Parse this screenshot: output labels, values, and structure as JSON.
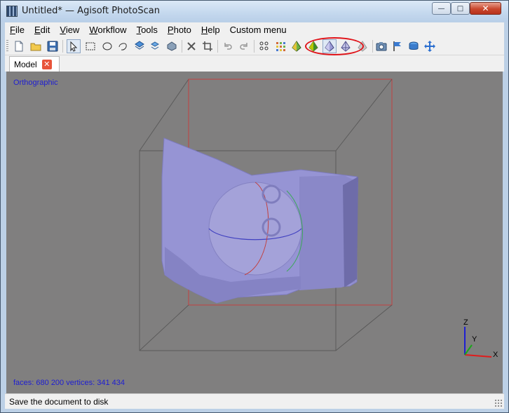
{
  "window": {
    "title": "Untitled* — Agisoft PhotoScan"
  },
  "controls": {
    "minimize": "—",
    "maximize": "□",
    "close": "✕"
  },
  "menu": {
    "items": [
      {
        "label": "File",
        "mnemonic": "F"
      },
      {
        "label": "Edit",
        "mnemonic": "E"
      },
      {
        "label": "View",
        "mnemonic": "V"
      },
      {
        "label": "Workflow",
        "mnemonic": "W"
      },
      {
        "label": "Tools",
        "mnemonic": "T"
      },
      {
        "label": "Photo",
        "mnemonic": "P"
      },
      {
        "label": "Help",
        "mnemonic": "H"
      },
      {
        "label": "Custom menu",
        "mnemonic": ""
      }
    ]
  },
  "toolbar": {
    "buttons": [
      "new-document-icon",
      "open-folder-icon",
      "save-icon",
      "navigation-pointer-icon",
      "rectangle-selection-icon",
      "circle-selection-icon",
      "free-form-selection-icon",
      "resize-region-icon",
      "move-region-icon",
      "rotate-region-icon",
      "delete-selection-icon",
      "crop-selection-icon",
      "undo-icon",
      "redo-icon",
      "point-cloud-icon",
      "dense-cloud-icon",
      "shaded-model-icon",
      "solid-model-icon",
      "wireframe-model-icon",
      "textured-model-icon",
      "show-cameras-icon",
      "show-markers-icon",
      "show-region-icon",
      "move-object-icon"
    ],
    "active": "solid-model-icon",
    "highlighted_group": [
      "shaded-model-icon",
      "solid-model-icon",
      "wireframe-model-icon"
    ]
  },
  "tabs": [
    {
      "label": "Model",
      "close": "✕"
    }
  ],
  "viewport": {
    "projection": "Orthographic",
    "stats": "faces: 680 200 vertices: 341 434",
    "axes": {
      "z": "Z",
      "y": "Y",
      "x": "X"
    },
    "colors": {
      "background": "#807f7f",
      "mesh": "#9694d4",
      "region": "#c24040",
      "bbox": "#5a5a5a",
      "label": "#1e1ed2"
    }
  },
  "status": {
    "text": "Save the document to disk"
  }
}
